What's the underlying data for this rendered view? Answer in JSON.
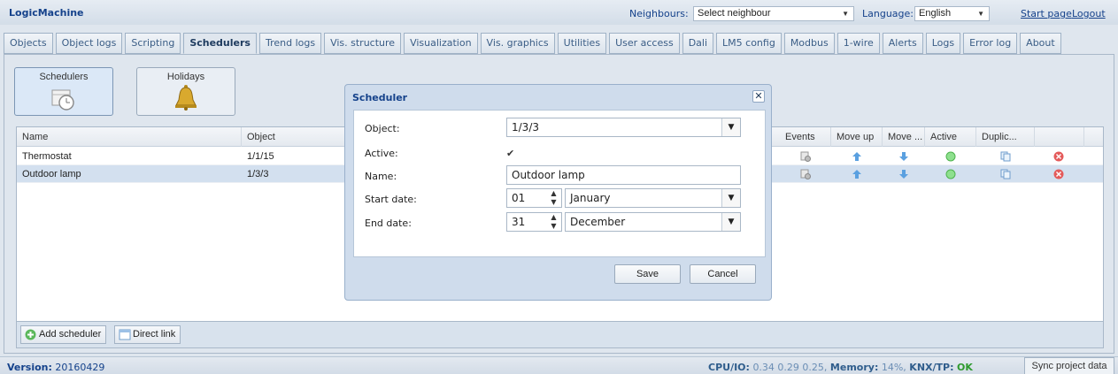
{
  "app": {
    "title": "LogicMachine"
  },
  "header": {
    "neighbours_label": "Neighbours:",
    "neighbours_value": "Select neighbour",
    "language_label": "Language:",
    "language_value": "English",
    "start_page": "Start page",
    "logout": "Logout"
  },
  "tabs": [
    {
      "label": "Objects"
    },
    {
      "label": "Object logs"
    },
    {
      "label": "Scripting"
    },
    {
      "label": "Schedulers",
      "active": true
    },
    {
      "label": "Trend logs"
    },
    {
      "label": "Vis. structure"
    },
    {
      "label": "Visualization"
    },
    {
      "label": "Vis. graphics"
    },
    {
      "label": "Utilities"
    },
    {
      "label": "User access"
    },
    {
      "label": "Dali"
    },
    {
      "label": "LM5 config"
    },
    {
      "label": "Modbus"
    },
    {
      "label": "1-wire"
    },
    {
      "label": "Alerts"
    },
    {
      "label": "Logs"
    },
    {
      "label": "Error log"
    },
    {
      "label": "About"
    }
  ],
  "subnav": {
    "schedulers": "Schedulers",
    "holidays": "Holidays"
  },
  "grid": {
    "columns": [
      "Name",
      "Object",
      "Events",
      "Move up",
      "Move ...",
      "Active",
      "Duplic..."
    ],
    "rows": [
      {
        "name": "Thermostat",
        "object": "1/1/15"
      },
      {
        "name": "Outdoor lamp",
        "object": "1/3/3"
      }
    ]
  },
  "footer": {
    "add_scheduler": "Add scheduler",
    "direct_link": "Direct link"
  },
  "modal": {
    "title": "Scheduler",
    "object_label": "Object:",
    "object_value": "1/3/3",
    "active_label": "Active:",
    "active_checked": true,
    "name_label": "Name:",
    "name_value": "Outdoor lamp",
    "start_label": "Start date:",
    "start_day": "01",
    "start_month": "January",
    "end_label": "End date:",
    "end_day": "31",
    "end_month": "December",
    "save": "Save",
    "cancel": "Cancel"
  },
  "status": {
    "version_label": "Version:",
    "version_value": "20160429",
    "cpu_label": "CPU/IO:",
    "cpu_value": "0.34 0.29 0.25",
    "memory_label": "Memory:",
    "memory_value": "14%",
    "knx_label": "KNX/TP:",
    "knx_value": "OK",
    "sync": "Sync project data"
  },
  "colors": {
    "accent": "#15428b",
    "ok": "#2e9a2e",
    "active_dot": "#7ddc7d",
    "delete": "#e45a5a"
  }
}
